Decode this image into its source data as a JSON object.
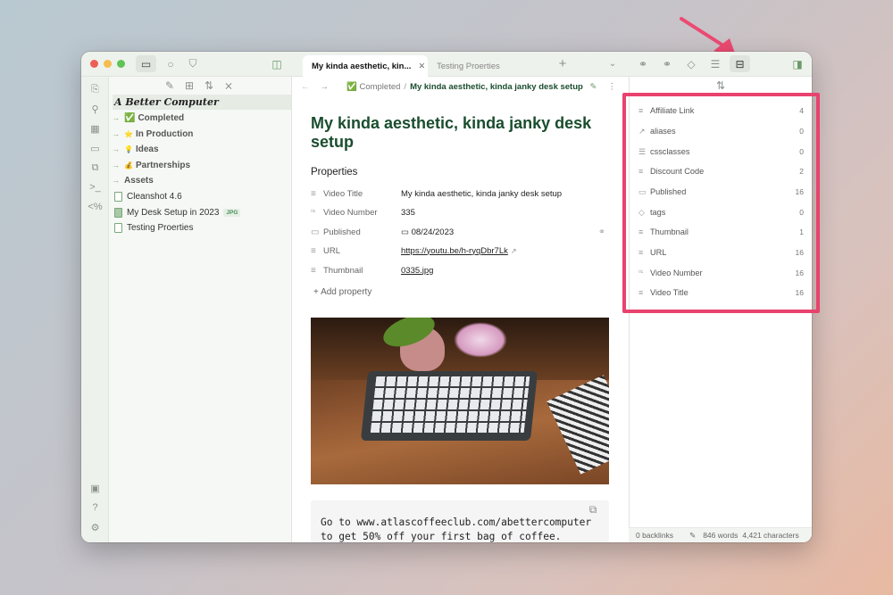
{
  "window": {
    "traffic_lights": [
      "#ee5e57",
      "#f5bd4f",
      "#5fc454"
    ]
  },
  "left_toolbar": {
    "icons": [
      "files-icon",
      "search-icon",
      "bookmark-icon",
      "sidebar-toggle-icon"
    ]
  },
  "ribbon": {
    "icons": [
      "open-quick-switcher-icon",
      "graph-icon",
      "canvas-icon",
      "calendar-icon",
      "copy-icon",
      "terminal-icon",
      "templater-icon"
    ],
    "bottom": [
      "vault-icon",
      "help-icon",
      "settings-icon"
    ]
  },
  "explorer": {
    "toolbar": [
      "new-note-icon",
      "new-folder-icon",
      "sort-icon",
      "collapse-icon"
    ],
    "vault_name": "A Better Computer",
    "items": [
      {
        "type": "folder",
        "emoji": "✅",
        "label": "Completed"
      },
      {
        "type": "folder",
        "emoji": "⭐",
        "label": "In Production"
      },
      {
        "type": "folder",
        "emoji": "💡",
        "label": "Ideas"
      },
      {
        "type": "folder",
        "emoji": "💰",
        "label": "Partnerships"
      },
      {
        "type": "folder",
        "emoji": "",
        "label": "Assets"
      },
      {
        "type": "file",
        "label": "Cleanshot 4.6"
      },
      {
        "type": "file",
        "label": "My Desk Setup in 2023",
        "badge": "JPG"
      },
      {
        "type": "file",
        "label": "Testing Proerties"
      }
    ]
  },
  "tabs": [
    {
      "label": "My kinda aesthetic, kin...",
      "active": true
    },
    {
      "label": "Testing Proerties",
      "active": false
    }
  ],
  "breadcrumb": {
    "folder": "✅ Completed",
    "separator": "/",
    "note": "My kinda aesthetic, kinda janky desk setup"
  },
  "note": {
    "title": "My kinda aesthetic, kinda janky desk setup",
    "properties_heading": "Properties",
    "properties": [
      {
        "icon": "≡",
        "key": "Video Title",
        "value": "My kinda aesthetic, kinda janky desk setup"
      },
      {
        "icon": "⁰¹",
        "key": "Video Number",
        "value": "335"
      },
      {
        "icon": "▭",
        "key": "Published",
        "value": "▭ 08/24/2023"
      },
      {
        "icon": "≡",
        "key": "URL",
        "value": "https://youtu.be/h-ryqDbr7Lk",
        "link": true
      },
      {
        "icon": "≡",
        "key": "Thumbnail",
        "value": "0335.jpg",
        "link": true
      }
    ],
    "add_property": "+ Add property",
    "code": "Go to www.atlascoffeeclub.com/abettercomputer to get 50% off your first bag of coffee."
  },
  "right_toolbar": {
    "icons": [
      "backlinks-icon",
      "outgoing-links-icon",
      "tags-icon",
      "outline-icon",
      "all-properties-icon",
      "sidebar-toggle-icon"
    ]
  },
  "all_properties": [
    {
      "icon": "≡",
      "name": "Affiliate Link",
      "count": "4"
    },
    {
      "icon": "↗",
      "name": "aliases",
      "count": "0"
    },
    {
      "icon": "☰",
      "name": "cssclasses",
      "count": "0"
    },
    {
      "icon": "≡",
      "name": "Discount Code",
      "count": "2"
    },
    {
      "icon": "▭",
      "name": "Published",
      "count": "16"
    },
    {
      "icon": "◇",
      "name": "tags",
      "count": "0"
    },
    {
      "icon": "≡",
      "name": "Thumbnail",
      "count": "1"
    },
    {
      "icon": "≡",
      "name": "URL",
      "count": "16"
    },
    {
      "icon": "⁰¹",
      "name": "Video Number",
      "count": "16"
    },
    {
      "icon": "≡",
      "name": "Video Title",
      "count": "16"
    }
  ],
  "status": {
    "backlinks": "0 backlinks",
    "words": "846 words",
    "characters": "4,421 characters"
  },
  "annotation": {
    "color": "#e8426e"
  }
}
